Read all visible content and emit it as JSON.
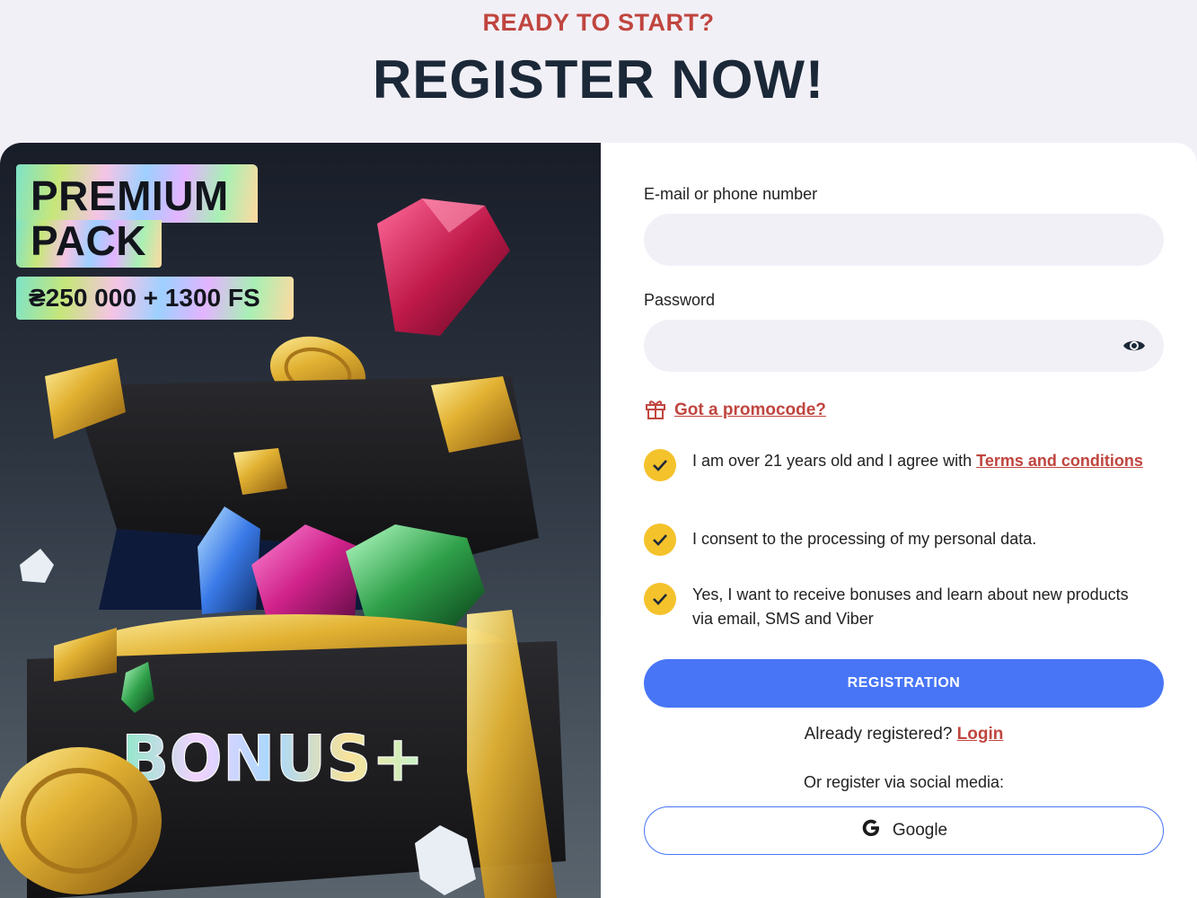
{
  "header": {
    "eyebrow": "READY TO START?",
    "title": "REGISTER NOW!"
  },
  "promo": {
    "pack_line1": "PREMIUM",
    "pack_line2": "PACK",
    "amount": "₴250 000 + 1300 FS",
    "chest_label": "BONUS+"
  },
  "form": {
    "email_label": "E-mail or phone number",
    "email_value": "",
    "password_label": "Password",
    "password_value": "",
    "promocode_link": "Got a promocode?",
    "checkboxes": [
      {
        "text": "I am over 21 years old and I agree with ",
        "link": "Terms and conditions",
        "checked": true
      },
      {
        "text": "I consent to the processing of my personal data.",
        "checked": true
      },
      {
        "text": "Yes, I want to receive bonuses and learn about new products via email, SMS and Viber",
        "checked": true
      }
    ],
    "register_button": "REGISTRATION",
    "already_text": "Already registered?",
    "login_link": "Login",
    "social_label": "Or register via social media:",
    "google_button": "Google"
  },
  "colors": {
    "accent_red": "#c0453f",
    "primary_blue": "#4775f5",
    "check_yellow": "#f4c22b",
    "title_dark": "#1b2838",
    "input_bg": "#f2f0f7"
  },
  "icons": [
    "eye-icon",
    "gift-icon",
    "checkmark-icon",
    "google-icon"
  ]
}
